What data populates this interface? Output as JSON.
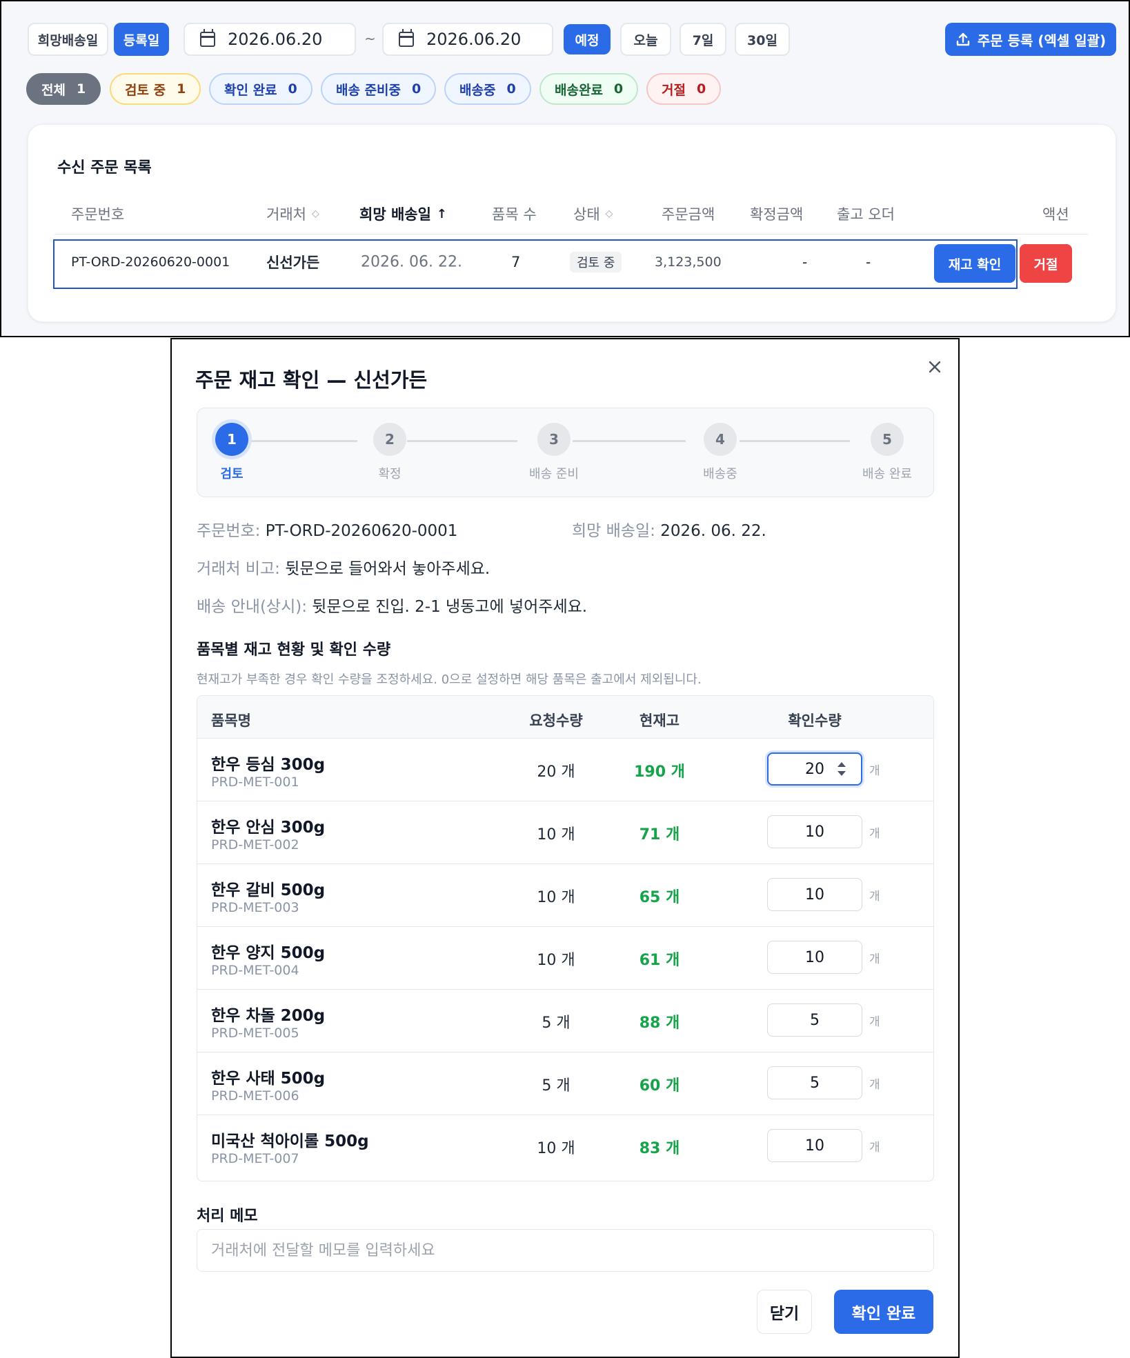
{
  "toolbar": {
    "date_type_options": [
      "희망배송일",
      "등록일"
    ],
    "date_type_selected": "등록일",
    "date_from": "2026.06.20",
    "date_to": "2026.06.20",
    "tilde": "~",
    "quick_ranges": [
      "예정",
      "오늘",
      "7일",
      "30일"
    ],
    "quick_selected": "예정",
    "upload_label": "주문 등록 (엑셀 일괄)"
  },
  "status_filters": [
    {
      "label": "전체",
      "count": "1"
    },
    {
      "label": "검토 중",
      "count": "1"
    },
    {
      "label": "확인 완료",
      "count": "0"
    },
    {
      "label": "배송 준비중",
      "count": "0"
    },
    {
      "label": "배송중",
      "count": "0"
    },
    {
      "label": "배송완료",
      "count": "0"
    },
    {
      "label": "거절",
      "count": "0"
    }
  ],
  "order_list": {
    "title": "수신 주문 목록",
    "columns": [
      "주문번호",
      "거래처",
      "희망 배송일",
      "품목 수",
      "상태",
      "주문금액",
      "확정금액",
      "출고 오더",
      "액션"
    ],
    "rows": [
      {
        "order_no": "PT-ORD-20260620-0001",
        "client": "신선가든",
        "delivery_date": "2026. 06. 22.",
        "item_count": "7",
        "status": "검토 중",
        "order_amount": "3,123,500",
        "confirmed_amount": "-",
        "shipping_order": "-",
        "actions": {
          "check_stock": "재고 확인",
          "reject": "거절"
        }
      }
    ]
  },
  "modal": {
    "title": "주문 재고 확인 — 신선가든",
    "steps": [
      {
        "num": "1",
        "label": "검토"
      },
      {
        "num": "2",
        "label": "확정"
      },
      {
        "num": "3",
        "label": "배송 준비"
      },
      {
        "num": "4",
        "label": "배송중"
      },
      {
        "num": "5",
        "label": "배송 완료"
      }
    ],
    "active_step": 1,
    "order_no_label": "주문번호:",
    "order_no": "PT-ORD-20260620-0001",
    "delivery_label": "희망 배송일:",
    "delivery_date": "2026. 06. 22.",
    "client_note_label": "거래처 비고:",
    "client_note": "뒷문으로 들어와서 놓아주세요.",
    "delivery_guide_label": "배송 안내(상시):",
    "delivery_guide": "뒷문으로 진입. 2-1 냉동고에 넣어주세요.",
    "section_title": "품목별 재고 현황 및 확인 수량",
    "section_hint": "현재고가 부족한 경우 확인 수량을 조정하세요. 0으로 설정하면 해당 품목은 출고에서 제외됩니다.",
    "table_headers": {
      "name": "품목명",
      "requested": "요청수량",
      "stock": "현재고",
      "confirm": "확인수량"
    },
    "unit": "개",
    "items": [
      {
        "name": "한우 등심 300g",
        "code": "PRD-MET-001",
        "requested": "20 개",
        "stock": "190 개",
        "confirm": "20"
      },
      {
        "name": "한우 안심 300g",
        "code": "PRD-MET-002",
        "requested": "10 개",
        "stock": "71 개",
        "confirm": "10"
      },
      {
        "name": "한우 갈비 500g",
        "code": "PRD-MET-003",
        "requested": "10 개",
        "stock": "65 개",
        "confirm": "10"
      },
      {
        "name": "한우 양지 500g",
        "code": "PRD-MET-004",
        "requested": "10 개",
        "stock": "61 개",
        "confirm": "10"
      },
      {
        "name": "한우 차돌 200g",
        "code": "PRD-MET-005",
        "requested": "5 개",
        "stock": "88 개",
        "confirm": "5"
      },
      {
        "name": "한우 사태 500g",
        "code": "PRD-MET-006",
        "requested": "5 개",
        "stock": "60 개",
        "confirm": "5"
      },
      {
        "name": "미국산 척아이롤 500g",
        "code": "PRD-MET-007",
        "requested": "10 개",
        "stock": "83 개",
        "confirm": "10"
      }
    ],
    "memo_title": "처리 메모",
    "memo_placeholder": "거래처에 전달할 메모를 입력하세요",
    "close_label": "닫기",
    "confirm_label": "확인 완료"
  },
  "colors": {
    "accent": "#2b6be8",
    "danger": "#ef4444",
    "stock_ok": "#16a34a"
  }
}
